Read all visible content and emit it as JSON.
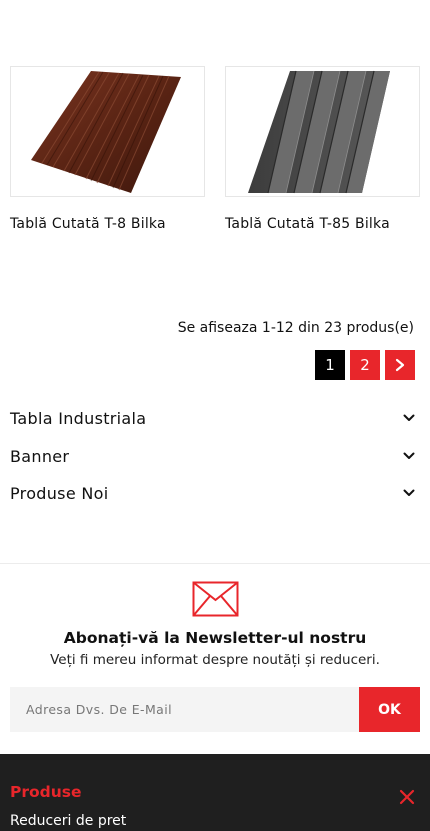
{
  "products": [
    {
      "title": "Tablă Cutată T-8 Bilka",
      "image": "brown-corrugated-sheet"
    },
    {
      "title": "Tablă Cutată T-85 Bilka",
      "image": "grey-trapezoidal-sheet"
    }
  ],
  "results": {
    "text": "Se afiseaza 1-12 din 23 produs(e)"
  },
  "pagination": {
    "current": "1",
    "next_page": "2",
    "next_icon": "chevron-right-icon"
  },
  "accordions": [
    {
      "label": "Tabla Industriala"
    },
    {
      "label": "Banner"
    },
    {
      "label": "Produse Noi"
    }
  ],
  "newsletter": {
    "icon": "envelope-icon",
    "title": "Abonați-vă la Newsletter-ul nostru",
    "subtitle": "Veți fi mereu informat despre noutăți și reduceri.",
    "placeholder": "Adresa Dvs. De E-Mail",
    "button": "OK"
  },
  "footer": {
    "section_title": "Produse",
    "first_item": "Reduceri de pret",
    "close_icon": "close-icon"
  },
  "colors": {
    "accent": "#e8262b",
    "dark": "#1f1f1f",
    "active_page": "#000000"
  }
}
